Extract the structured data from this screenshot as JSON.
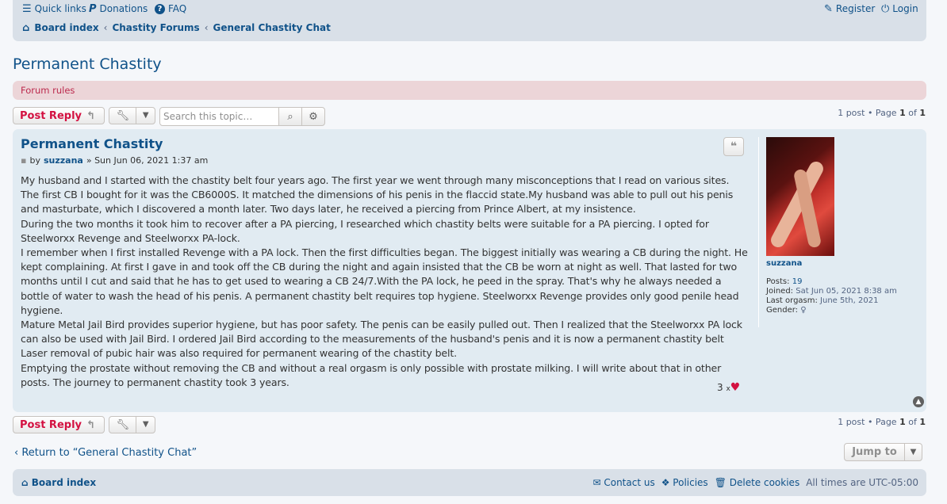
{
  "header": {
    "quick_links": "Quick links",
    "donations": "Donations",
    "faq": "FAQ",
    "register": "Register",
    "login": "Login",
    "breadcrumbs": [
      "Board index",
      "Chastity Forums",
      "General Chastity Chat"
    ]
  },
  "topic": {
    "title": "Permanent Chastity",
    "forum_rules": "Forum rules"
  },
  "actions": {
    "post_reply": "Post Reply",
    "search_placeholder": "Search this topic…",
    "pagination_prefix": "1 post • Page",
    "page_current": "1",
    "page_of": "of",
    "page_total": "1"
  },
  "post": {
    "title": "Permanent Chastity",
    "by": "by",
    "author": "suzzana",
    "date": "» Sun Jun 06, 2021 1:37 am",
    "content": [
      "My husband and I started with the chastity belt four years ago. The first year we went through many misconceptions that I read on various sites. The first CB I bought for it was the CB6000S. It matched the dimensions of his penis in the flaccid state.My husband was able to pull out his penis and masturbate, which I discovered a month later. Two days later, he received a piercing from Prince Albert, at my insistence.",
      "During the two months it took him to recover after a PA piercing, I researched which chastity belts were suitable for a PA piercing. I opted for Steelworxx Revenge and Steelworxx PA-lock.",
      "I remember when I first installed Revenge with a PA lock. Then the first difficulties began. The biggest initially was wearing a CB during the night. He kept complaining. At first I gave in and took off the CB during the night and again insisted that the CB be worn at night as well. That lasted for two months until I cut and said that he has to get used to wearing a CB 24/7.With the PA lock, he peed in the spray. That's why he always needed a bottle of water to wash the head of his penis. A permanent chastity belt requires top hygiene. Steelworxx Revenge provides only good penile head hygiene.",
      "Mature Metal Jail Bird provides superior hygiene, but has poor safety. The penis can be easily pulled out. Then I realized that the Steelworxx PA lock can also be used with Jail Bird. I ordered Jail Bird according to the measurements of the husband's penis and it is now a permanent chastity belt",
      "Laser removal of pubic hair was also required for permanent wearing of the chastity belt.",
      "Emptying the prostate without removing the CB and without a real orgasm is only possible with prostate milking. I will write about that in other posts. The journey to permanent chastity took 3 years."
    ],
    "likes_count": "3",
    "likes_x": "x"
  },
  "profile": {
    "username": "suzzana",
    "posts_label": "Posts:",
    "posts_value": "19",
    "joined_label": "Joined:",
    "joined_value": "Sat Jun 05, 2021 8:38 am",
    "orgasm_label": "Last orgasm:",
    "orgasm_value": "June 5th, 2021",
    "gender_label": "Gender:",
    "gender_value": "♀"
  },
  "bottom": {
    "return_link": "Return to “General Chastity Chat”",
    "jump_to": "Jump to"
  },
  "footer": {
    "board_index": "Board index",
    "contact": "Contact us",
    "policies": "Policies",
    "delete_cookies": "Delete cookies",
    "timezone": "All times are UTC-05:00"
  },
  "icons": [
    "bars-icon",
    "paypal-icon",
    "question-icon",
    "register-icon",
    "power-icon",
    "home-icon",
    "wrench-icon",
    "search-icon",
    "gear-icon",
    "quote-icon",
    "file-icon",
    "heart-icon",
    "arrow-up-icon",
    "envelope-icon",
    "cubes-icon",
    "trash-icon"
  ],
  "colors": {
    "link": "#105289",
    "accent": "#d31141",
    "post_bg": "#e1ebf2",
    "bar_bg": "#d9e0e8",
    "rules_bg": "#ecd5d8"
  }
}
